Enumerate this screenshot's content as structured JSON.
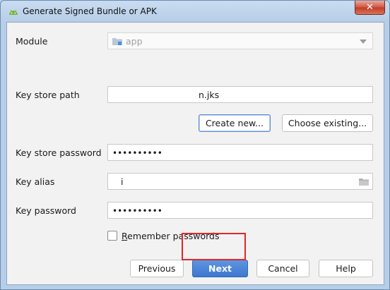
{
  "window": {
    "title": "Generate Signed Bundle or APK",
    "close_label": "✕"
  },
  "form": {
    "module": {
      "label": "Module",
      "value": "app"
    },
    "keystore_path": {
      "label": "Key store path",
      "value": "n.jks"
    },
    "create_new_label": "Create new...",
    "choose_existing_label": "Choose existing...",
    "keystore_password": {
      "label": "Key store password",
      "value": "••••••••••"
    },
    "key_alias": {
      "label": "Key alias",
      "value": "i"
    },
    "key_password": {
      "label": "Key password",
      "value": "••••••••••"
    },
    "remember_passwords": {
      "label_first": "R",
      "label_rest": "emember passwords",
      "checked": false
    }
  },
  "buttons": {
    "previous": "Previous",
    "next": "Next",
    "cancel": "Cancel",
    "help": "Help"
  },
  "colors": {
    "primary": "#3e78cf",
    "highlight": "#e0262a"
  }
}
